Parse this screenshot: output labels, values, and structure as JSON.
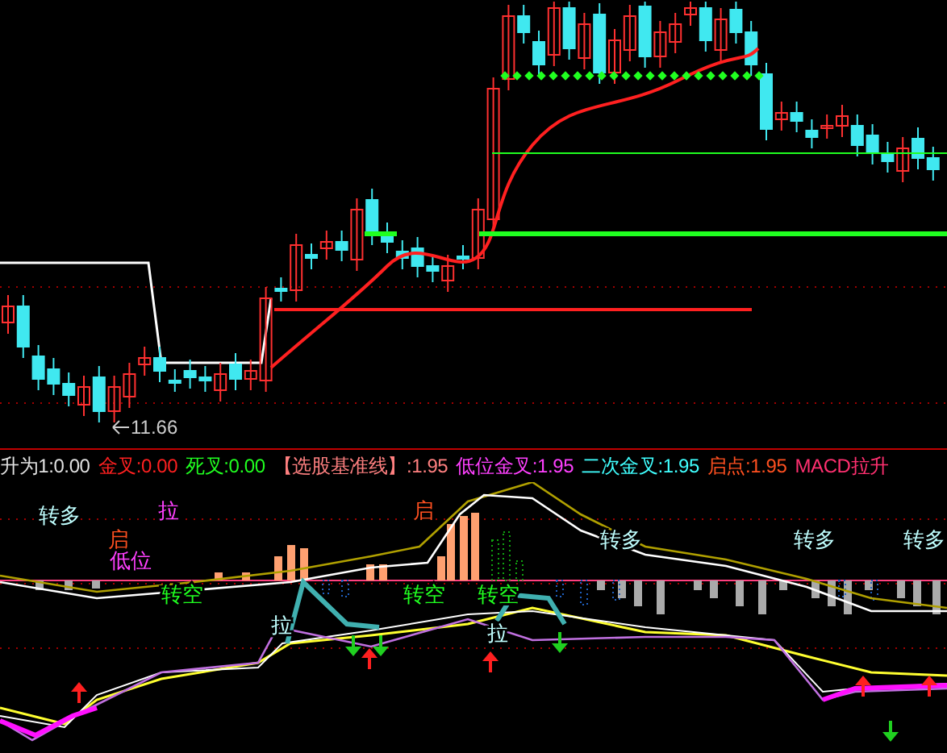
{
  "price_chart": {
    "low_label": "11.66"
  },
  "indicator_bar": [
    {
      "text": "升为1:0.00",
      "color": "#e0e0e0"
    },
    {
      "text": "金叉:0.00",
      "color": "#ff2020"
    },
    {
      "text": "死叉:0.00",
      "color": "#20ff20"
    },
    {
      "text": "【选股基准线】:1.95",
      "color": "#ff8080"
    },
    {
      "text": "低位金叉:1.95",
      "color": "#ff40ff"
    },
    {
      "text": "二次金叉:1.95",
      "color": "#40ffff"
    },
    {
      "text": "启点:1.95",
      "color": "#ff5020"
    },
    {
      "text": "MACD拉升",
      "color": "#ff3070"
    }
  ],
  "signals": [
    {
      "text": "转多",
      "color": "#c0ffff"
    },
    {
      "text": "启",
      "color": "#ff5020"
    },
    {
      "text": "低位",
      "color": "#ff40ff"
    },
    {
      "text": "拉",
      "color": "#ff40ff"
    },
    {
      "text": "转空",
      "color": "#20ff20"
    },
    {
      "text": "转空",
      "color": "#20ff20"
    },
    {
      "text": "启",
      "color": "#ff5020"
    },
    {
      "text": "转空",
      "color": "#20ff20"
    },
    {
      "text": "转多",
      "color": "#c0ffff"
    },
    {
      "text": "转多",
      "color": "#c0ffff"
    },
    {
      "text": "转多",
      "color": "#c0ffff"
    },
    {
      "text": "拉",
      "color": "#c0ffff"
    },
    {
      "text": "拉",
      "color": "#c0ffff"
    }
  ]
}
